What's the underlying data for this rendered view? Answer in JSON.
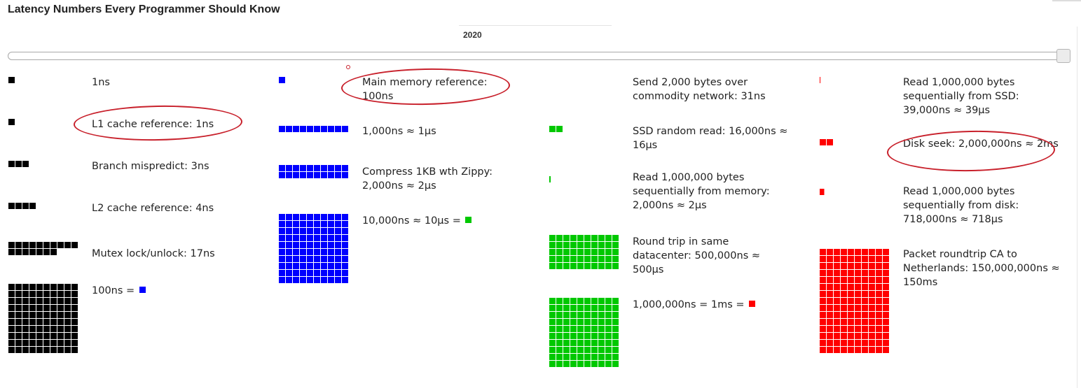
{
  "title": "Latency Numbers Every Programmer Should Know",
  "year": "2020",
  "slider": {
    "selected_year": "2020"
  },
  "colors": {
    "ns_block": "#000000",
    "hundred_ns_block": "#0000ff",
    "ten_us_block": "#00c800",
    "ms_block": "#ff0000",
    "annotation": "#c8202b"
  },
  "columns": [
    [
      {
        "label": "1ns",
        "squares": 1,
        "color": "#000000"
      },
      {
        "label": "L1 cache reference: 1ns",
        "squares": 1,
        "color": "#000000"
      },
      {
        "label": "Branch mispredict: 3ns",
        "squares": 3,
        "color": "#000000"
      },
      {
        "label": "L2 cache reference: 4ns",
        "squares": 4,
        "color": "#000000"
      },
      {
        "label": "Mutex lock/unlock: 17ns",
        "squares": 17,
        "color": "#000000"
      },
      {
        "label": "100ns = ",
        "squares": 100,
        "color": "#000000",
        "suffix_color": "#0000ff"
      }
    ],
    [
      {
        "label": "Main memory reference: 100ns",
        "squares": 1,
        "color": "#0000ff"
      },
      {
        "label": "1,000ns ≈ 1μs",
        "squares": 10,
        "color": "#0000ff"
      },
      {
        "label": "Compress 1KB wth Zippy: 2,000ns ≈ 2μs",
        "squares": 20,
        "color": "#0000ff"
      },
      {
        "label": "10,000ns ≈ 10μs = ",
        "squares": 100,
        "color": "#0000ff",
        "suffix_color": "#00c800"
      }
    ],
    [
      {
        "label": "Send 2,000 bytes over commodity network: 31ns",
        "squares": 0,
        "color": "#00c800"
      },
      {
        "label": "SSD random read: 16,000ns ≈ 16μs",
        "squares": 2,
        "color": "#00c800"
      },
      {
        "label": "Read 1,000,000 bytes sequentially from memory: 2,000ns ≈ 2μs",
        "squares": 0.2,
        "color": "#00c800"
      },
      {
        "label": "Round trip in same datacenter: 500,000ns ≈ 500μs",
        "squares": 50,
        "color": "#00c800"
      },
      {
        "label": "1,000,000ns = 1ms = ",
        "squares": 100,
        "color": "#00c800",
        "suffix_color": "#ff0000"
      }
    ],
    [
      {
        "label": "Read 1,000,000 bytes sequentially from SSD: 39,000ns ≈ 39μs",
        "squares": 0.04,
        "color": "#ff0000"
      },
      {
        "label": "Disk seek: 2,000,000ns ≈ 2ms",
        "squares": 2,
        "color": "#ff0000"
      },
      {
        "label": "Read 1,000,000 bytes sequentially from disk: 718,000ns ≈ 718μs",
        "squares": 0.7,
        "color": "#ff0000"
      },
      {
        "label": "Packet roundtrip CA to Netherlands: 150,000,000ns ≈ 150ms",
        "squares": 150,
        "color": "#ff0000"
      }
    ]
  ]
}
